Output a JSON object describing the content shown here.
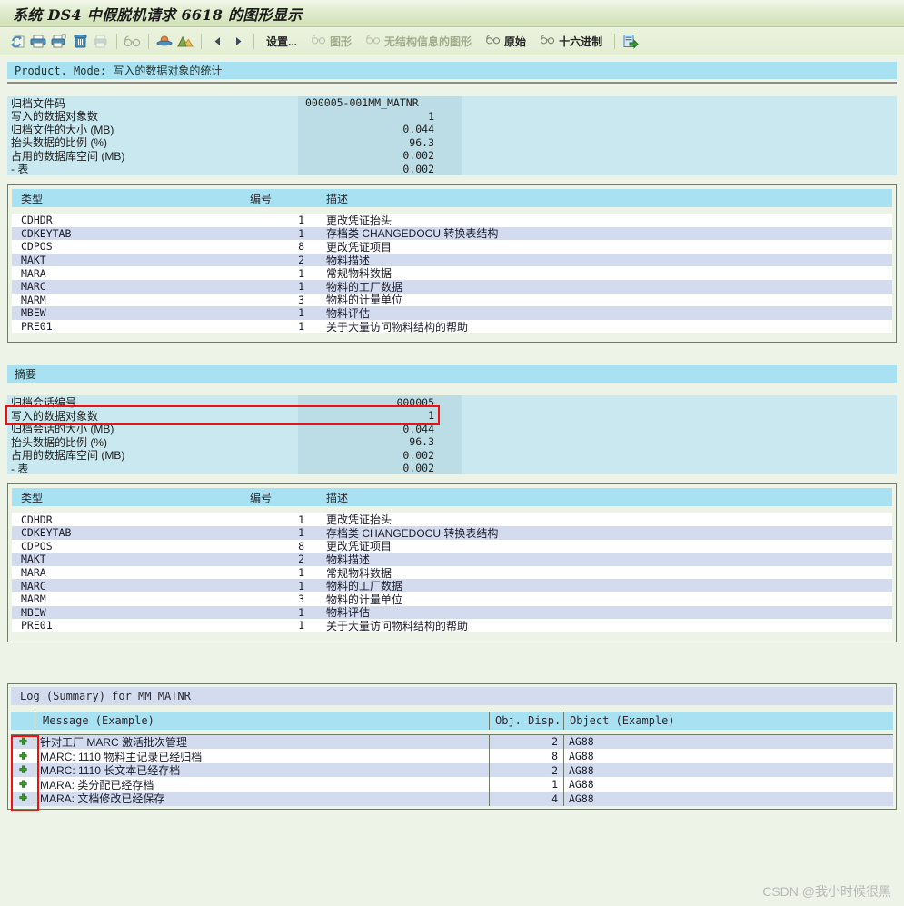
{
  "window": {
    "title": "系统 DS4 中假脱机请求 6618 的图形显示"
  },
  "toolbar": {
    "icons": [
      {
        "name": "refresh-icon",
        "glyph": "⟳"
      },
      {
        "name": "print-icon",
        "glyph": "🖨"
      },
      {
        "name": "print-preview-icon",
        "glyph": "🖶"
      },
      {
        "name": "delete-icon",
        "glyph": "🗑"
      },
      {
        "name": "print-disabled-icon",
        "glyph": "🖨"
      },
      {
        "name": "glasses-icon",
        "glyph": "👓"
      },
      {
        "name": "hat-icon",
        "glyph": "🎩"
      },
      {
        "name": "picture-icon",
        "glyph": "🖼"
      },
      {
        "name": "previous-page-icon",
        "glyph": "◀"
      },
      {
        "name": "next-page-icon",
        "glyph": "▶"
      }
    ],
    "settings_label": "设置...",
    "graphic_label": "图形",
    "graphic_nostruct_label": "无结构信息的图形",
    "raw_label": "原始",
    "hex_label": "十六进制",
    "export_icon": "export-icon"
  },
  "section_header": "Product. Mode: 写入的数据对象的统计",
  "stats_top": [
    {
      "label": "归档文件码",
      "value": "000005-001MM_MATNR",
      "align": "left"
    },
    {
      "label": "写入的数据对象数",
      "value": "1",
      "align": "right"
    },
    {
      "label": "归档文件的大小 (MB)",
      "value": "0.044",
      "align": "right"
    },
    {
      "label": "抬头数据的比例 (%)",
      "value": "96.3",
      "align": "right"
    },
    {
      "label": "占用的数据库空间 (MB)",
      "value": "0.002",
      "align": "right"
    },
    {
      "label": "- 表",
      "value": "0.002",
      "align": "right"
    }
  ],
  "table_columns": {
    "type": "类型",
    "number": "编号",
    "description": "描述"
  },
  "table_rows": [
    {
      "type": "CDHDR",
      "number": "1",
      "description": "更改凭证抬头"
    },
    {
      "type": "CDKEYTAB",
      "number": "1",
      "description": "存档类 CHANGEDOCU 转换表结构"
    },
    {
      "type": "CDPOS",
      "number": "8",
      "description": "更改凭证项目"
    },
    {
      "type": "MAKT",
      "number": "2",
      "description": "物料描述"
    },
    {
      "type": "MARA",
      "number": "1",
      "description": "常规物料数据"
    },
    {
      "type": "MARC",
      "number": "1",
      "description": "物料的工厂数据"
    },
    {
      "type": "MARM",
      "number": "3",
      "description": "物料的计量单位"
    },
    {
      "type": "MBEW",
      "number": "1",
      "description": "物料评估"
    },
    {
      "type": "PRE01",
      "number": "1",
      "description": "关于大量访问物料结构的帮助"
    }
  ],
  "summary_header": "摘要",
  "stats_summary": [
    {
      "label": "归档会话编号",
      "value": "000005",
      "align": "right",
      "highlight": true
    },
    {
      "label": "写入的数据对象数",
      "value": "1",
      "align": "right"
    },
    {
      "label": "归档会话的大小 (MB)",
      "value": "0.044",
      "align": "right"
    },
    {
      "label": "抬头数据的比例 (%)",
      "value": "96.3",
      "align": "right"
    },
    {
      "label": "占用的数据库空间 (MB)",
      "value": "0.002",
      "align": "right"
    },
    {
      "label": "- 表",
      "value": "0.002",
      "align": "right"
    }
  ],
  "log": {
    "title": "Log (Summary) for MM_MATNR",
    "columns": {
      "status": "",
      "message": "Message (Example)",
      "obj_disp": "Obj. Disp.",
      "object": "Object (Example)"
    },
    "rows": [
      {
        "status": "success-icon",
        "message": "针对工厂 MARC 激活批次管理",
        "obj_disp": "2",
        "object": "AG88"
      },
      {
        "status": "success-icon",
        "message": "MARC: 1110 物料主记录已经归档",
        "obj_disp": "8",
        "object": "AG88"
      },
      {
        "status": "success-icon",
        "message": "MARC: 1110 长文本已经存档",
        "obj_disp": "2",
        "object": "AG88"
      },
      {
        "status": "success-icon",
        "message": "MARA:  类分配已经存档",
        "obj_disp": "1",
        "object": "AG88"
      },
      {
        "status": "success-icon",
        "message": "MARA:  文档修改已经保存",
        "obj_disp": "4",
        "object": "AG88"
      }
    ]
  },
  "watermark": "CSDN @我小时候很黑",
  "colors": {
    "title_bar": "#cfe0b5",
    "band_cyan": "#a8e2f2",
    "stats_label_bg": "#c9e8f0",
    "stats_value_bg": "#bcdde6",
    "row_alt": "#d3dcef",
    "page_bg": "#eef3e7",
    "highlight": "#ee1111",
    "status_green": "#3a9a2e"
  }
}
